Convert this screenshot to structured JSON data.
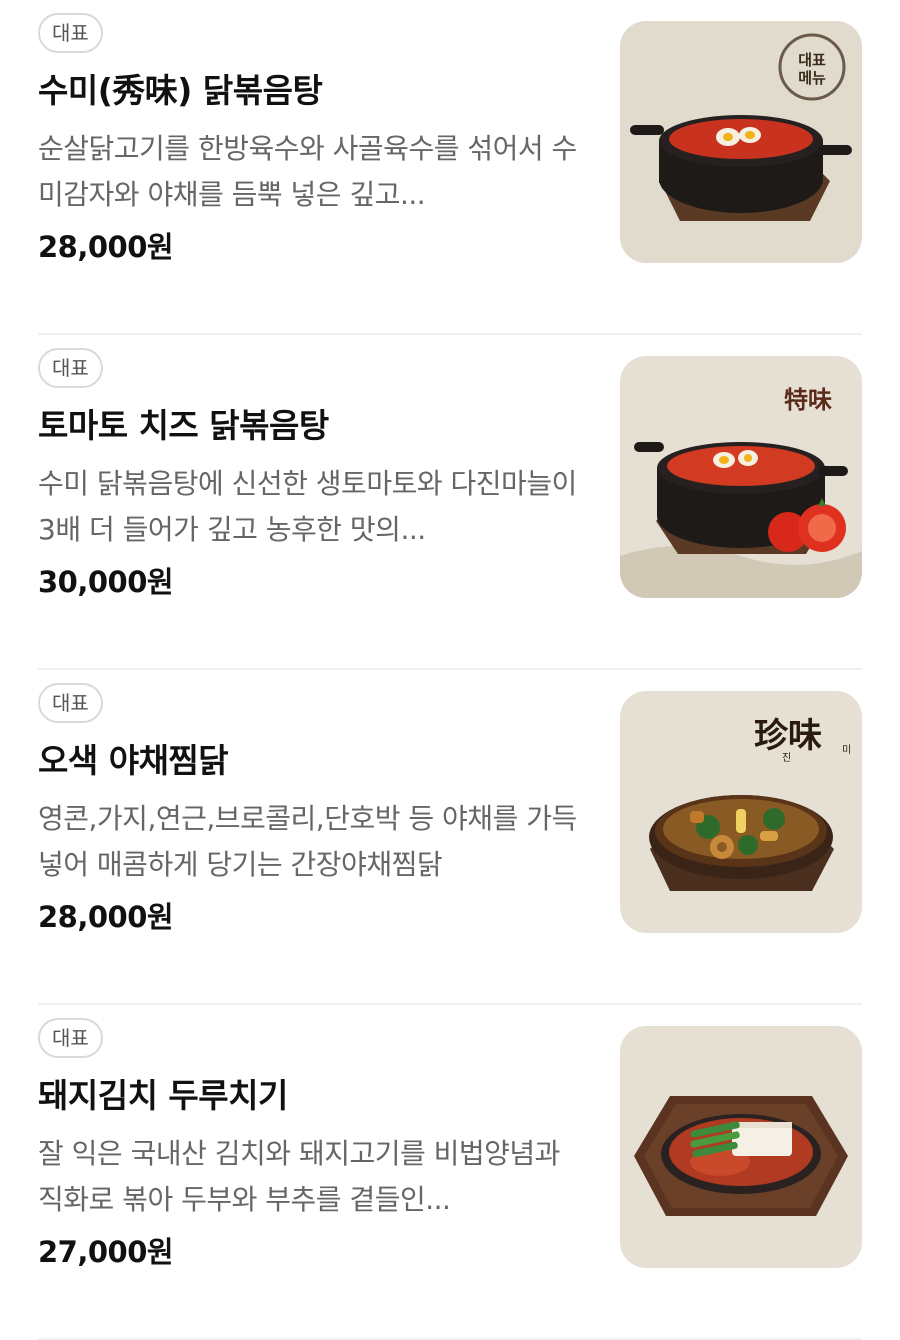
{
  "menu": {
    "items": [
      {
        "badge": "대표",
        "name": "수미(秀味) 닭볶음탕",
        "description": "순살닭고기를 한방육수와 사골육수를 섞어서 수미감자와 야채를 듬뿍 넣은 깊고...",
        "price": "28,000원",
        "image_label_line1": "대표",
        "image_label_line2": "메뉴",
        "image_icon": "stew-pot-icon"
      },
      {
        "badge": "대표",
        "name": "토마토 치즈 닭볶음탕",
        "description": "수미 닭볶음탕에 신선한 생토마토와 다진마늘이 3배 더 들어가 깊고 농후한 맛의...",
        "price": "30,000원",
        "image_label": "特味",
        "image_icon": "tomato-stew-icon"
      },
      {
        "badge": "대표",
        "name": "오색 야채찜닭",
        "description": "영콘,가지,연근,브로콜리,단호박 등 야채를 가득 넣어 매콤하게 당기는 간장야채찜닭",
        "price": "28,000원",
        "image_label": "珍味",
        "image_label_sub1": "진",
        "image_label_sub2": "미",
        "image_icon": "braised-chicken-icon"
      },
      {
        "badge": "대표",
        "name": "돼지김치 두루치기",
        "description": "잘 익은 국내산 김치와 돼지고기를 비법양념과 직화로 볶아 두부와 부추를 곁들인...",
        "price": "27,000원",
        "image_icon": "kimchi-pork-plate-icon"
      }
    ]
  },
  "colors": {
    "badge_border": "#d9d9d9",
    "description_text": "#666666",
    "thumb_background": "#e6e0d4",
    "stew_red": "#c8321e"
  }
}
